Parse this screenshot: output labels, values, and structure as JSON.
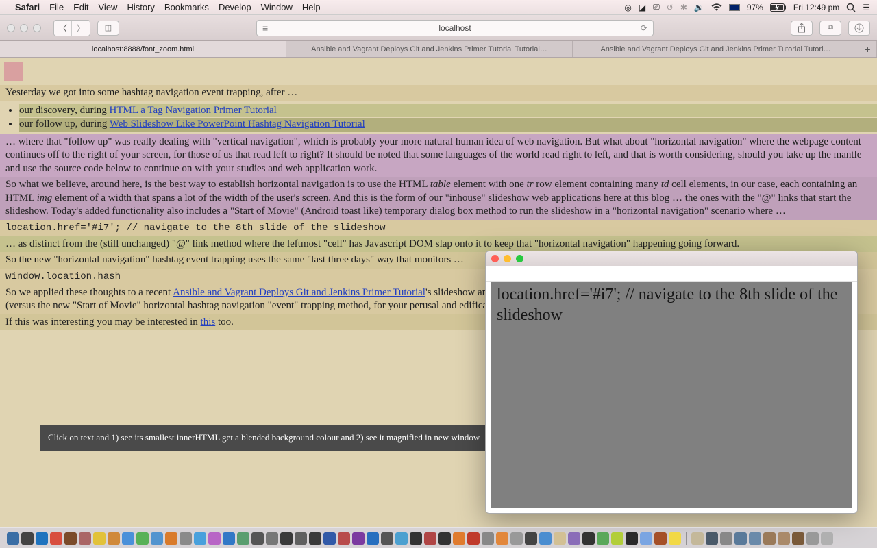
{
  "menubar": {
    "app": "Safari",
    "items": [
      "File",
      "Edit",
      "View",
      "History",
      "Bookmarks",
      "Develop",
      "Window",
      "Help"
    ],
    "battery": "97%",
    "clock": "Fri 12:49 pm"
  },
  "toolbar": {
    "url": "localhost"
  },
  "tabs": [
    "localhost:8888/font_zoom.html",
    "Ansible and Vagrant Deploys Git and Jenkins Primer Tutorial Tutorial…",
    "Ansible and Vagrant Deploys Git and Jenkins Primer Tutorial Tutori…"
  ],
  "page": {
    "intro": "Yesterday we got into some hashtag navigation event trapping, after …",
    "li1_pre": "our discovery, during ",
    "li1_link": "HTML a Tag Navigation Primer Tutorial",
    "li2_pre": "our follow up, during ",
    "li2_link": "Web Slideshow Like PowerPoint Hashtag Navigation Tutorial",
    "para2": "… where that \"follow up\" was really dealing with \"vertical navigation\", which is probably your more natural human idea of web navigation. But what about \"horizontal navigation\" where the webpage content continues off to the right of your screen, for those of us that read left to right? It should be noted that some languages of the world read right to left, and that is worth considering, should you take up the mantle and use the source code below to continue on with your studies and web application work.",
    "para3a": "So what we believe, around here, is the best way to establish horizontal navigation is to use the HTML ",
    "para3b": " element with one ",
    "para3c": " row element containing many ",
    "para3d": " cell elements, in our case, each containing an HTML ",
    "para3e": " element of a width that spans a lot of the width of the user's screen. And this is the form of our \"inhouse\" slideshow web applications here at this blog … the ones with the \"@\" links that start the slideshow. Today's added functionality also includes a \"Start of Movie\" (Android toast like) temporary dialog box method to run the slideshow in a \"horizontal navigation\" scenario where …",
    "table": "table",
    "tr": "tr",
    "td": "td",
    "img": "img",
    "code1": "location.href='#i7'; // navigate to the 8th slide of the slideshow",
    "para4": "… as distinct from the (still unchanged) \"@\" link method where the leftmost \"cell\" has Javascript DOM slap onto it to keep that \"horizontal navigation\" happening going forward.",
    "para5": "So the new \"horizontal navigation\" hashtag event trapping uses the same \"last three days\" way that monitors …",
    "code2": "window.location.hash",
    "para6a": "So we applied these thoughts to a recent ",
    "para6link": "Ansible and Vagrant Deploys Git and Jenkins Primer Tutorial",
    "para6b": "'s slideshow and so those thoughts resulted in this live run link and its tutorial_to_animated_gif.php PHP (versus the new \"Start of Movie\" horizontal hashtag navigation \"event\" trapping method, for your perusal and edification.",
    "para7a": "If this was interesting you may be interested in ",
    "para7link": "this",
    "para7b": " too.",
    "tooltip": "Click on text and 1) see its smallest innerHTML get a blended background colour and 2) see it magnified in new window"
  },
  "popup": {
    "text": "location.href='#i7'; // navigate to the 8th slide of the slideshow"
  }
}
